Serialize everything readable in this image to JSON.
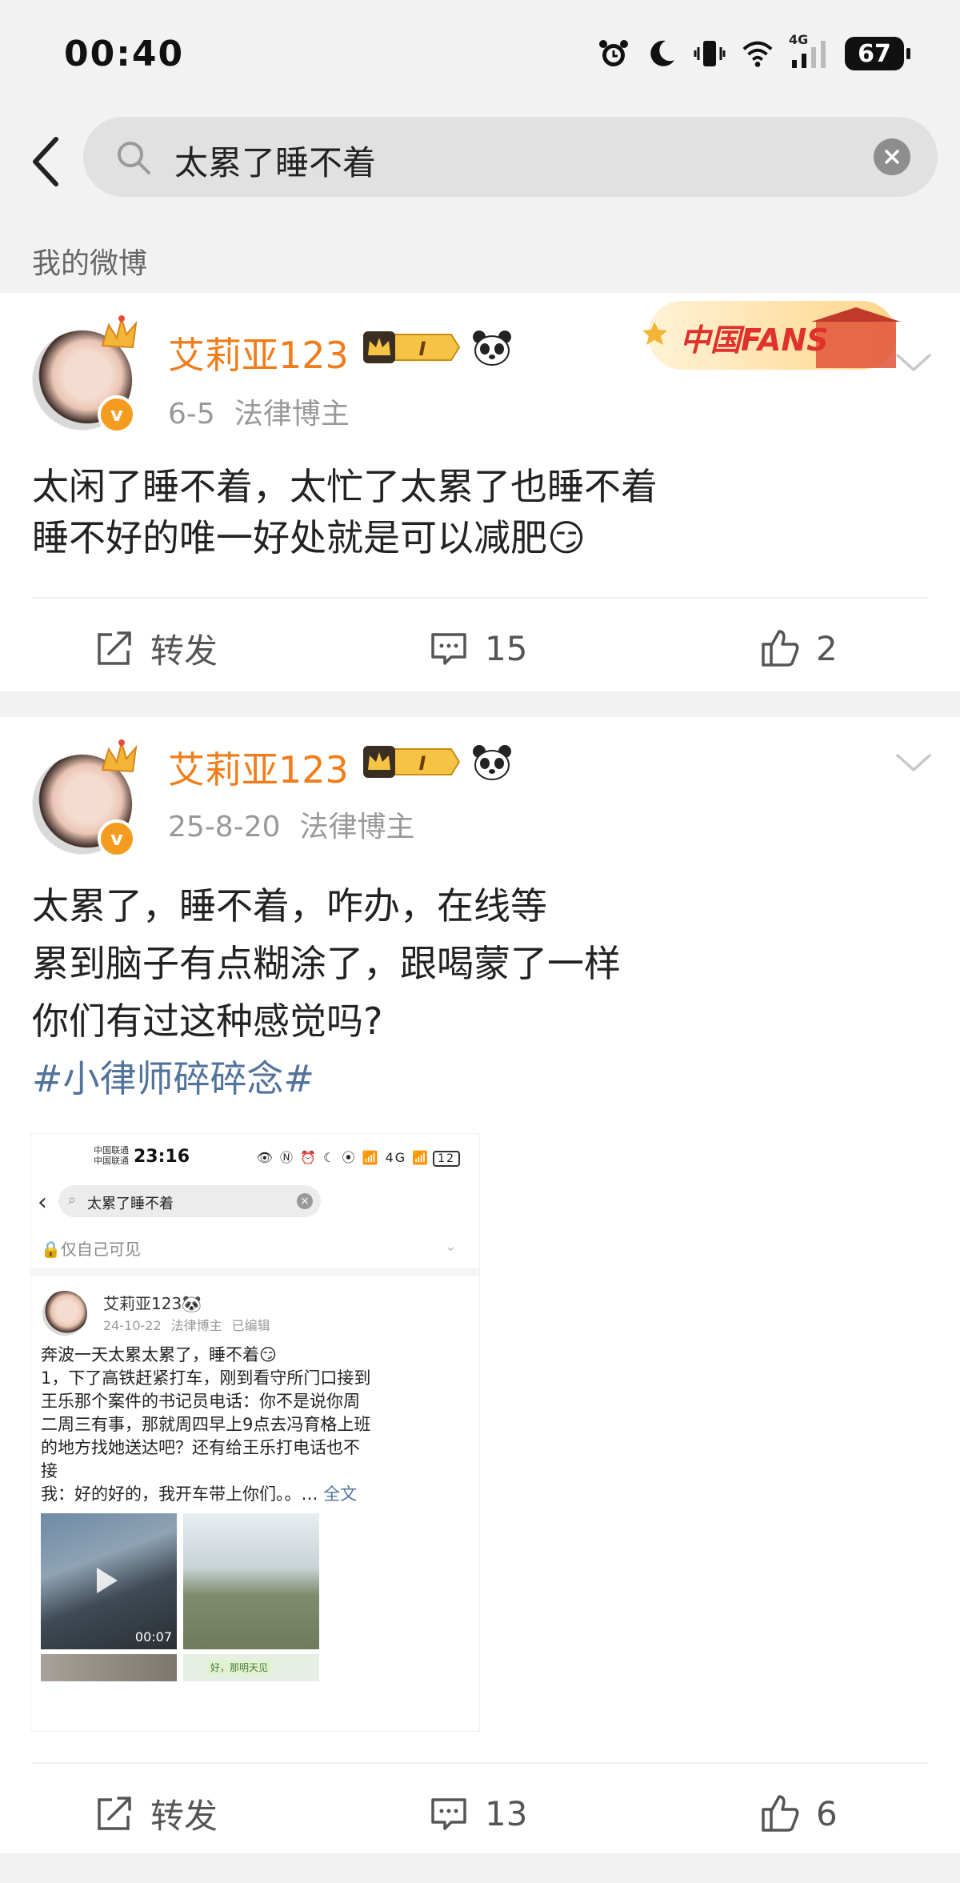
{
  "status_bar": {
    "time": "00:40",
    "network_label": "4G",
    "battery": "67",
    "icons": [
      "alarm-icon",
      "moon-icon",
      "vibrate-icon",
      "wifi-icon",
      "signal-icon",
      "battery-icon"
    ]
  },
  "search": {
    "query": "太累了睡不着"
  },
  "section": {
    "label": "我的微博"
  },
  "posts": [
    {
      "username": "艾莉亚123",
      "vip_level": "I",
      "date": "6-5",
      "role": "法律博主",
      "banner_text": "中国FANS",
      "lines": [
        "太闲了睡不着，太忙了太累了也睡不着",
        "睡不好的唯一好处就是可以减肥😏"
      ],
      "actions": {
        "repost": "转发",
        "comments": "15",
        "likes": "2"
      }
    },
    {
      "username": "艾莉亚123",
      "vip_level": "I",
      "date": "25-8-20",
      "role": "法律博主",
      "lines": [
        "太累了，睡不着，咋办，在线等",
        "累到脑子有点糊涂了，跟喝蒙了一样",
        "你们有过这种感觉吗?"
      ],
      "topic": "#小律师碎碎念#",
      "actions": {
        "repost": "转发",
        "comments": "13",
        "likes": "6"
      }
    }
  ],
  "embedded": {
    "carrier_1": "中国联通",
    "carrier_2": "中国联通",
    "time": "23:16",
    "status_icons": "👁 Ⓝ ⏰ ☾ ⦿ 📶 4G 📶",
    "battery": "12",
    "query": "太累了睡不着",
    "visibility": "仅自己可见",
    "username": "艾莉亚123🐼",
    "date": "24-10-22",
    "role": "法律博主",
    "edited": "已编辑",
    "body_lines": [
      "奔波一天太累太累了，睡不着😏",
      "1，下了高铁赶紧打车，刚到看守所门口接到",
      "王乐那个案件的书记员电话：你不是说你周",
      "二周三有事，那就周四早上9点去冯育格上班",
      "的地方找她送达吧？还有给王乐打电话也不",
      "接",
      "我：好的好的，我开车带上你们。。… "
    ],
    "full_text_link": "全文",
    "video_duration": "00:07",
    "thumb_caption": "好，那明天见"
  }
}
